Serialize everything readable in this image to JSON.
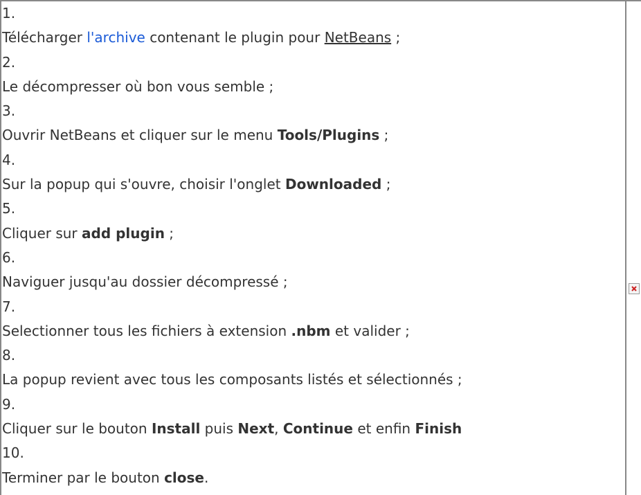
{
  "steps": [
    {
      "number": "1.",
      "parts": [
        "Télécharger ",
        "l'archive",
        " contenant le plugin pour ",
        "NetBeans",
        " ;"
      ]
    },
    {
      "number": "2.",
      "parts": [
        "Le décompresser où bon vous semble ;"
      ]
    },
    {
      "number": "3.",
      "parts": [
        "Ouvrir NetBeans et cliquer sur le menu ",
        "Tools/Plugins",
        " ;"
      ]
    },
    {
      "number": "4.",
      "parts": [
        "Sur la popup qui s'ouvre, choisir l'onglet ",
        "Downloaded",
        " ;"
      ]
    },
    {
      "number": "5.",
      "parts": [
        "Cliquer sur ",
        "add plugin",
        " ;"
      ]
    },
    {
      "number": "6.",
      "parts": [
        "Naviguer jusqu'au dossier décompressé ;"
      ]
    },
    {
      "number": "7.",
      "parts": [
        "Selectionner tous les fichiers à extension ",
        ".nbm",
        " et valider ;"
      ]
    },
    {
      "number": "8.",
      "parts": [
        "La popup revient avec tous les composants listés et sélectionnés ;"
      ]
    },
    {
      "number": "9.",
      "parts": [
        "Cliquer sur le bouton ",
        "Install",
        " puis ",
        "Next",
        ", ",
        "Continue",
        " et enfin ",
        "Finish"
      ]
    },
    {
      "number": "10.",
      "parts": [
        "Terminer par le bouton ",
        "close",
        "."
      ]
    }
  ],
  "colors": {
    "text": "#333333",
    "link": "#1b5bd7",
    "border": "#888888",
    "broken_image_x": "#cc2222"
  },
  "icons": {
    "broken_image": "broken-image-icon"
  }
}
